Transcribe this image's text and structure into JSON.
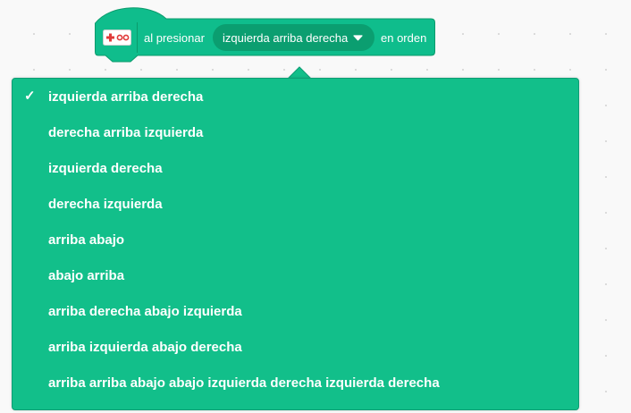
{
  "block": {
    "icon": "makey-makey-extension-icon",
    "label_before": "al presionar",
    "selected_value": "izquierda arriba derecha",
    "label_after": "en orden"
  },
  "colors": {
    "block_fill": "#0fbd8c",
    "block_border": "#0b9b6c",
    "field_fill": "#0b9e70",
    "menu_fill": "#12bf8a"
  },
  "menu": {
    "check_mark": "✓",
    "items": [
      {
        "label": "izquierda arriba derecha",
        "selected": true
      },
      {
        "label": "derecha arriba izquierda",
        "selected": false
      },
      {
        "label": "izquierda derecha",
        "selected": false
      },
      {
        "label": "derecha izquierda",
        "selected": false
      },
      {
        "label": "arriba abajo",
        "selected": false
      },
      {
        "label": "abajo arriba",
        "selected": false
      },
      {
        "label": "arriba derecha abajo izquierda",
        "selected": false
      },
      {
        "label": "arriba izquierda abajo derecha",
        "selected": false
      },
      {
        "label": "arriba arriba abajo abajo izquierda derecha izquierda derecha",
        "selected": false
      }
    ]
  }
}
